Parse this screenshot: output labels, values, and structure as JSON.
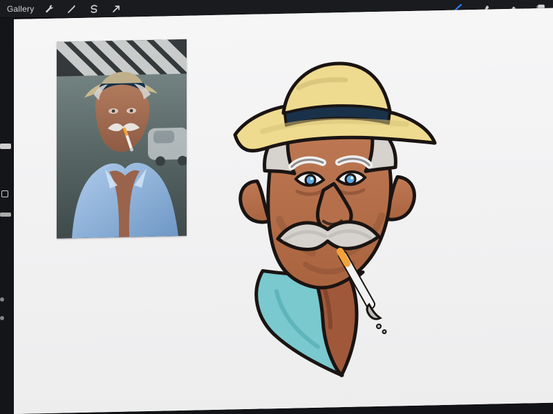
{
  "topbar": {
    "gallery_label": "Gallery",
    "left_icons": [
      "wrench-icon",
      "magic-wand-icon",
      "selection-icon",
      "transform-arrow-icon"
    ],
    "right_icons": [
      "brush-icon",
      "smudge-icon",
      "eraser-icon",
      "layers-icon"
    ],
    "active_tool_color": "#2f7cff"
  },
  "colors": {
    "app_bg": "#121316",
    "canvas_bg": "#f2f2f3",
    "hat": "#efdb8f",
    "hat_band": "#19324a",
    "skin": "#b56f4b",
    "skin_shadow": "#8e5236",
    "hair": "#d6d3cf",
    "scarf": "#79c9cf",
    "outline": "#1a1412",
    "cigarette_filter": "#f2a33a"
  }
}
